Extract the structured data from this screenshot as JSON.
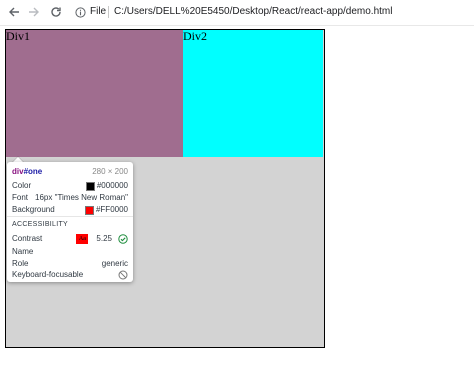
{
  "browser": {
    "info_label": "File",
    "url": "C:/Users/DELL%20E5450/Desktop/React/react-app/demo.html"
  },
  "page": {
    "div1_text": "Div1",
    "div2_text": "Div2"
  },
  "inspector": {
    "tag": "div",
    "id": "#one",
    "dimensions": "280 × 200",
    "color_label": "Color",
    "color_value": "#000000",
    "font_label": "Font",
    "font_value": "16px \"Times New Roman\"",
    "background_label": "Background",
    "background_value": "#FF0000",
    "section_title": "ACCESSIBILITY",
    "contrast_label": "Contrast",
    "contrast_chip": "Aa",
    "contrast_value": "5.25",
    "name_label": "Name",
    "role_label": "Role",
    "role_value": "generic",
    "keyboard_label": "Keyboard-focusable"
  },
  "colors": {
    "div_one_bg": "#a06d8f",
    "div_two_bg": "#00ffff",
    "container_bg": "#d3d3d3",
    "swatch_color": "#000000",
    "swatch_background": "#FF0000",
    "contrast_ok": "#1e8e3e"
  },
  "icons": {
    "back": "back-arrow-icon",
    "forward": "forward-arrow-icon",
    "reload": "reload-icon",
    "info": "info-icon",
    "contrast_ok": "check-circle-icon",
    "not_focusable": "no-entry-icon"
  }
}
